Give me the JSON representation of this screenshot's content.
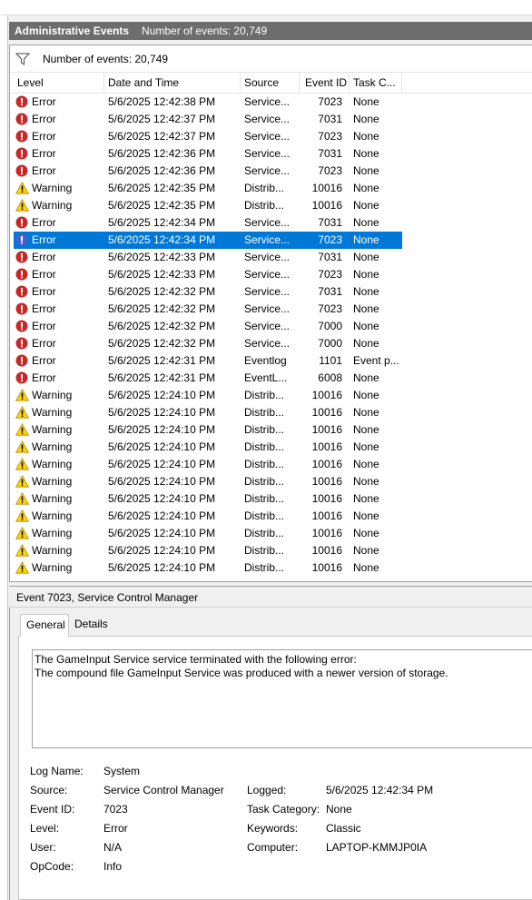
{
  "panel": {
    "title": "Administrative Events",
    "count_label": "Number of events: 20,749"
  },
  "filter": {
    "icon": "filter-icon",
    "count_label": "Number of events: 20,749"
  },
  "columns": {
    "level": "Level",
    "date": "Date and Time",
    "source": "Source",
    "event_id": "Event ID",
    "task": "Task C..."
  },
  "events": [
    {
      "level": "Error",
      "date": "5/6/2025 12:42:38 PM",
      "source": "Service...",
      "id": "7023",
      "task": "None",
      "icon": "error-icon"
    },
    {
      "level": "Error",
      "date": "5/6/2025 12:42:37 PM",
      "source": "Service...",
      "id": "7031",
      "task": "None",
      "icon": "error-icon"
    },
    {
      "level": "Error",
      "date": "5/6/2025 12:42:37 PM",
      "source": "Service...",
      "id": "7023",
      "task": "None",
      "icon": "error-icon"
    },
    {
      "level": "Error",
      "date": "5/6/2025 12:42:36 PM",
      "source": "Service...",
      "id": "7031",
      "task": "None",
      "icon": "error-icon"
    },
    {
      "level": "Error",
      "date": "5/6/2025 12:42:36 PM",
      "source": "Service...",
      "id": "7023",
      "task": "None",
      "icon": "error-icon"
    },
    {
      "level": "Warning",
      "date": "5/6/2025 12:42:35 PM",
      "source": "Distrib...",
      "id": "10016",
      "task": "None",
      "icon": "warning-icon"
    },
    {
      "level": "Warning",
      "date": "5/6/2025 12:42:35 PM",
      "source": "Distrib...",
      "id": "10016",
      "task": "None",
      "icon": "warning-icon"
    },
    {
      "level": "Error",
      "date": "5/6/2025 12:42:34 PM",
      "source": "Service...",
      "id": "7031",
      "task": "None",
      "icon": "error-icon"
    },
    {
      "level": "Error",
      "date": "5/6/2025 12:42:34 PM",
      "source": "Service...",
      "id": "7023",
      "task": "None",
      "icon": "error-icon",
      "selected": true
    },
    {
      "level": "Error",
      "date": "5/6/2025 12:42:33 PM",
      "source": "Service...",
      "id": "7031",
      "task": "None",
      "icon": "error-icon"
    },
    {
      "level": "Error",
      "date": "5/6/2025 12:42:33 PM",
      "source": "Service...",
      "id": "7023",
      "task": "None",
      "icon": "error-icon"
    },
    {
      "level": "Error",
      "date": "5/6/2025 12:42:32 PM",
      "source": "Service...",
      "id": "7031",
      "task": "None",
      "icon": "error-icon"
    },
    {
      "level": "Error",
      "date": "5/6/2025 12:42:32 PM",
      "source": "Service...",
      "id": "7023",
      "task": "None",
      "icon": "error-icon"
    },
    {
      "level": "Error",
      "date": "5/6/2025 12:42:32 PM",
      "source": "Service...",
      "id": "7000",
      "task": "None",
      "icon": "error-icon"
    },
    {
      "level": "Error",
      "date": "5/6/2025 12:42:32 PM",
      "source": "Service...",
      "id": "7000",
      "task": "None",
      "icon": "error-icon"
    },
    {
      "level": "Error",
      "date": "5/6/2025 12:42:31 PM",
      "source": "Eventlog",
      "id": "1101",
      "task": "Event p...",
      "icon": "error-icon"
    },
    {
      "level": "Error",
      "date": "5/6/2025 12:42:31 PM",
      "source": "EventL...",
      "id": "6008",
      "task": "None",
      "icon": "error-icon"
    },
    {
      "level": "Warning",
      "date": "5/6/2025 12:24:10 PM",
      "source": "Distrib...",
      "id": "10016",
      "task": "None",
      "icon": "warning-icon"
    },
    {
      "level": "Warning",
      "date": "5/6/2025 12:24:10 PM",
      "source": "Distrib...",
      "id": "10016",
      "task": "None",
      "icon": "warning-icon"
    },
    {
      "level": "Warning",
      "date": "5/6/2025 12:24:10 PM",
      "source": "Distrib...",
      "id": "10016",
      "task": "None",
      "icon": "warning-icon"
    },
    {
      "level": "Warning",
      "date": "5/6/2025 12:24:10 PM",
      "source": "Distrib...",
      "id": "10016",
      "task": "None",
      "icon": "warning-icon"
    },
    {
      "level": "Warning",
      "date": "5/6/2025 12:24:10 PM",
      "source": "Distrib...",
      "id": "10016",
      "task": "None",
      "icon": "warning-icon"
    },
    {
      "level": "Warning",
      "date": "5/6/2025 12:24:10 PM",
      "source": "Distrib...",
      "id": "10016",
      "task": "None",
      "icon": "warning-icon"
    },
    {
      "level": "Warning",
      "date": "5/6/2025 12:24:10 PM",
      "source": "Distrib...",
      "id": "10016",
      "task": "None",
      "icon": "warning-icon"
    },
    {
      "level": "Warning",
      "date": "5/6/2025 12:24:10 PM",
      "source": "Distrib...",
      "id": "10016",
      "task": "None",
      "icon": "warning-icon"
    },
    {
      "level": "Warning",
      "date": "5/6/2025 12:24:10 PM",
      "source": "Distrib...",
      "id": "10016",
      "task": "None",
      "icon": "warning-icon"
    },
    {
      "level": "Warning",
      "date": "5/6/2025 12:24:10 PM",
      "source": "Distrib...",
      "id": "10016",
      "task": "None",
      "icon": "warning-icon"
    },
    {
      "level": "Warning",
      "date": "5/6/2025 12:24:10 PM",
      "source": "Distrib...",
      "id": "10016",
      "task": "None",
      "icon": "warning-icon"
    }
  ],
  "detail": {
    "title": "Event 7023, Service Control Manager",
    "tabs": {
      "general": "General",
      "details": "Details"
    },
    "message_line1": "The GameInput Service service terminated with the following error:",
    "message_line2": "The compound file GameInput Service was produced with a newer version of storage.",
    "props": {
      "log_name_label": "Log Name:",
      "log_name": "System",
      "source_label": "Source:",
      "source": "Service Control Manager",
      "logged_label": "Logged:",
      "logged": "5/6/2025 12:42:34 PM",
      "event_id_label": "Event ID:",
      "event_id": "7023",
      "task_cat_label": "Task Category:",
      "task_cat": "None",
      "level_label": "Level:",
      "level": "Error",
      "keywords_label": "Keywords:",
      "keywords": "Classic",
      "user_label": "User:",
      "user": "N/A",
      "computer_label": "Computer:",
      "computer": "LAPTOP-KMMJP0IA",
      "opcode_label": "OpCode:",
      "opcode": "Info"
    }
  },
  "colors": {
    "selection": "#0078d7",
    "header": "#6d6d6d",
    "error": "#d32f2f",
    "warning": "#ffd700",
    "info": "#3a5fcd"
  }
}
